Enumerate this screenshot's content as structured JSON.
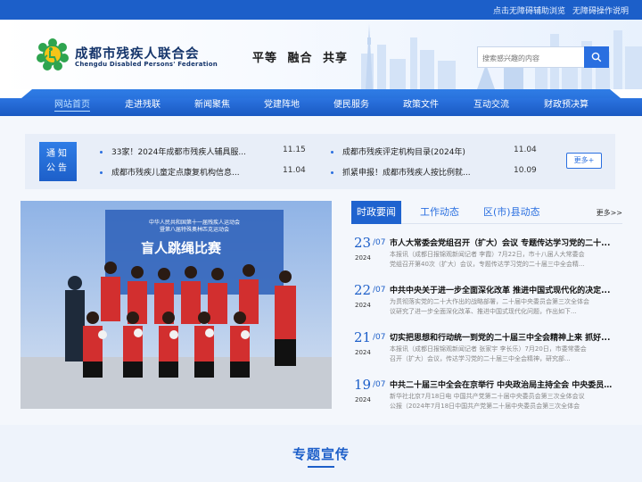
{
  "topbar": {
    "accessibility_assist": "点击无障碍辅助浏览",
    "accessibility_help": "无障碍操作说明"
  },
  "header": {
    "org_name_cn": "成都市残疾人联合会",
    "org_name_en": "Chengdu Disabled Persons' Federation",
    "slogan": "平等  融合  共享",
    "search_placeholder": "搜索感兴趣的内容",
    "logo_icon": "federation-logo-icon",
    "search_icon": "search-icon"
  },
  "nav": {
    "items": [
      "网站首页",
      "走进残联",
      "新闻聚焦",
      "党建阵地",
      "便民服务",
      "政策文件",
      "互动交流",
      "财政预决算"
    ],
    "active_index": 0
  },
  "notice": {
    "label_line1": "通知",
    "label_line2": "公告",
    "items": [
      {
        "title": "33家！2024年成都市残疾人辅具服...",
        "date": "11.15"
      },
      {
        "title": "成都市残疾评定机构目录(2024年)",
        "date": "11.04"
      },
      {
        "title": "成都市残疾儿童定点康复机构信息...",
        "date": "11.04"
      },
      {
        "title": "抓紧申报！成都市残疾人按比例就...",
        "date": "10.09"
      }
    ],
    "more": "更多+"
  },
  "photo": {
    "banner_line1": "中华人民共和国第十一届残疾人运动会",
    "banner_line2": "暨第八届特殊奥林匹克运动会",
    "banner_title": "盲人跳绳比赛"
  },
  "news": {
    "tabs": [
      "时政要闻",
      "工作动态",
      "区(市)县动态"
    ],
    "active_tab": 0,
    "more": "更多>>",
    "items": [
      {
        "day": "23",
        "month": "/07",
        "year": "2024",
        "title": "市人大常委会党组召开（扩大）会议 专题传达学习党的二十...",
        "summary": "本报讯（成都日报锦观新闻记者 李霞）7月22日，市十八届人大常委会党组召开第40次（扩大）会议，专题传达学习党的二十届三中全会精..."
      },
      {
        "day": "22",
        "month": "/07",
        "year": "2024",
        "title": "中共中央关于进一步全面深化改革 推进中国式现代化的决定...",
        "summary": "为贯彻落实党的二十大作出的战略部署，二十届中央委员会第三次全体会议研究了进一步全面深化改革、推进中国式现代化问题，作出如下..."
      },
      {
        "day": "21",
        "month": "/07",
        "year": "2024",
        "title": "切实把思想和行动统一到党的二十届三中全会精神上来 抓好...",
        "summary": "本报讯（成都日报锦观新闻记者 张家宇 李长乐）7月20日，市委常委会召开（扩大）会议，传达学习党的二十届三中全会精神，研究部..."
      },
      {
        "day": "19",
        "month": "/07",
        "year": "2024",
        "title": "中共二十届三中全会在京举行 中央政治局主持全会 中央委员...",
        "summary": "新华社北京7月18日电 中国共产党第二十届中央委员会第三次全体会议公报（2024年7月18日中国共产党第二十届中央委员会第三次全体会议..."
      }
    ]
  },
  "special": {
    "title": "专题宣传"
  },
  "colors": {
    "primary": "#1d5fc9",
    "accent": "#2a6fe0",
    "dark_text": "#15356b"
  }
}
